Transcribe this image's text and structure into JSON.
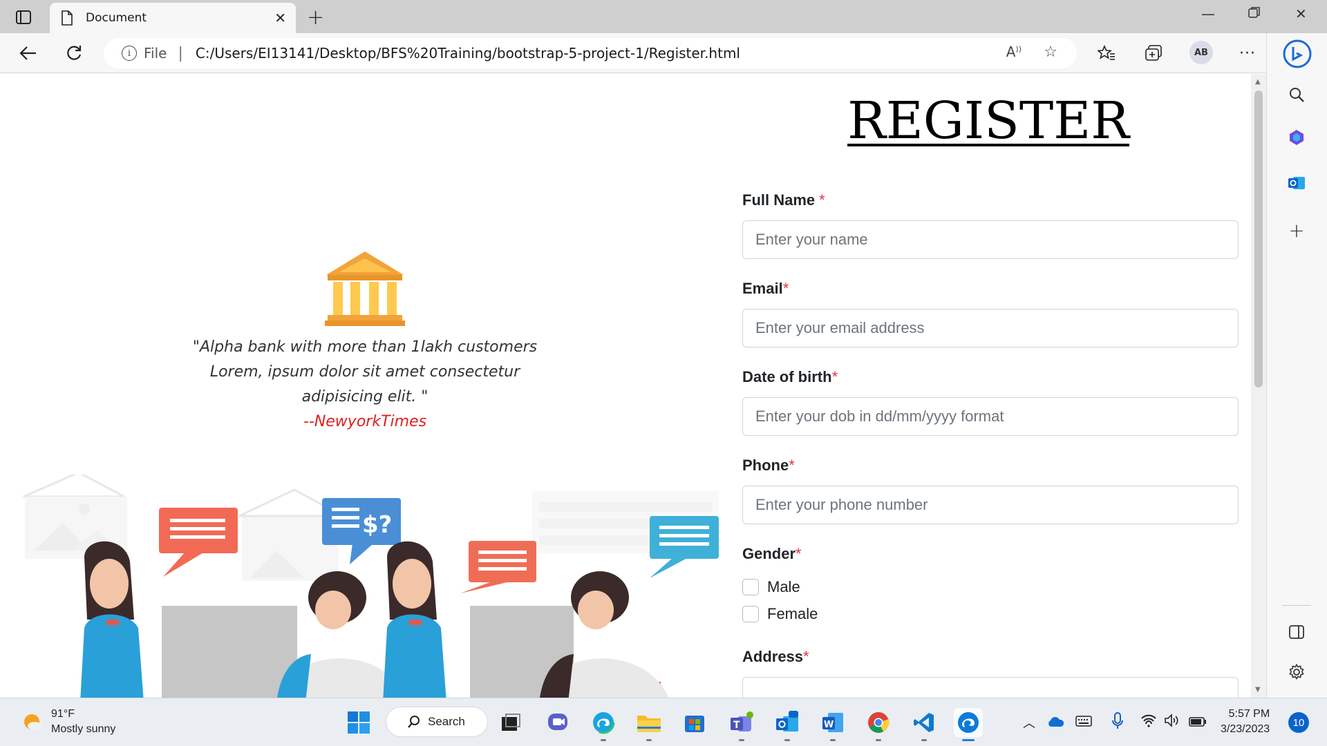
{
  "browser": {
    "tab_title": "Document",
    "address": {
      "scheme_label": "File",
      "url": "C:/Users/EI13141/Desktop/BFS%20Training/bootstrap-5-project-1/Register.html"
    },
    "profile_initials": "AB"
  },
  "page": {
    "left": {
      "quote_lines": [
        "\"Alpha bank with more than 1lakh customers",
        "Lorem, ipsum dolor sit amet consectetur",
        "adipisicing elit. \""
      ],
      "quote_source": "--NewyorkTimes"
    },
    "form": {
      "title": "REGISTER",
      "fields": [
        {
          "label": "Full Name",
          "required_mark": "*",
          "placeholder": "Enter your name"
        },
        {
          "label": "Email",
          "required_mark": "*",
          "placeholder": "Enter your email address"
        },
        {
          "label": "Date of birth",
          "required_mark": "*",
          "placeholder": "Enter your dob in dd/mm/yyyy format"
        },
        {
          "label": "Phone",
          "required_mark": "*",
          "placeholder": "Enter your phone number"
        }
      ],
      "gender": {
        "label": "Gender",
        "required_mark": "*",
        "options": [
          "Male",
          "Female"
        ]
      },
      "address": {
        "label": "Address",
        "required_mark": "*"
      }
    }
  },
  "taskbar": {
    "weather": {
      "temp": "91°F",
      "condition": "Mostly sunny"
    },
    "search_label": "Search",
    "clock": {
      "time": "5:57 PM",
      "date": "3/23/2023"
    },
    "notification_count": "10"
  }
}
